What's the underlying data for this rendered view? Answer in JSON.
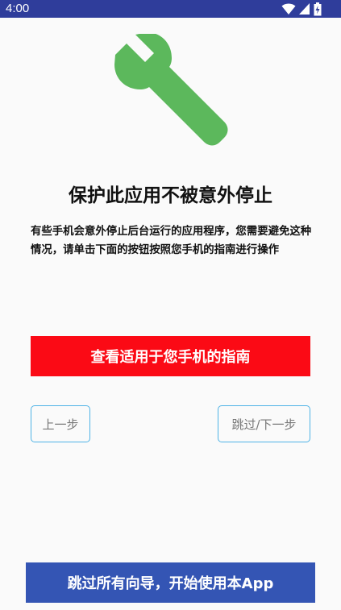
{
  "status_bar": {
    "time": "4:00",
    "icons": [
      "wifi-icon",
      "signal-icon",
      "battery-icon"
    ],
    "background_color": "#2f3d9b"
  },
  "hero": {
    "icon": "wrench-icon",
    "icon_color": "#5cb85c"
  },
  "title": "保护此应用不被意外停止",
  "description": "有些手机会意外停止后台运行的应用程序，您需要避免这种情况，请单击下面的按钮按照您手机的指南进行操作",
  "buttons": {
    "guide_label": "查看适用于您手机的指南",
    "guide_color": "#fb0a15",
    "prev_label": "上一步",
    "skip_next_label": "跳过/下一步",
    "outline_color": "#4fb3e6",
    "skip_all_label": "跳过所有向导，开始使用本App",
    "skip_all_color": "#3455b4"
  }
}
